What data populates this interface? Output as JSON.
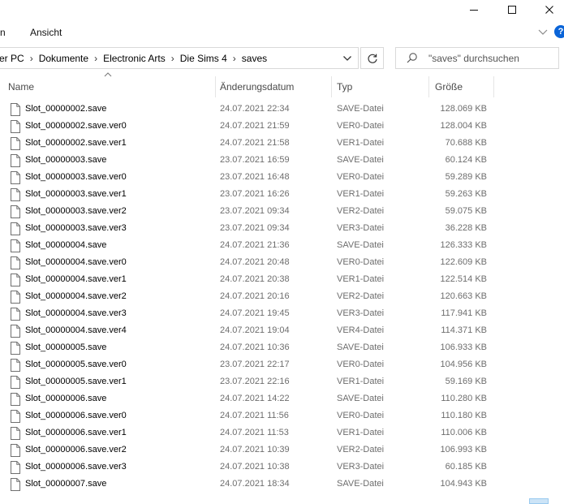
{
  "window": {
    "controls": [
      "minimize-icon",
      "maximize-icon",
      "close-icon"
    ]
  },
  "ribbon": {
    "tabs": [
      {
        "label": "n"
      },
      {
        "label": "Ansicht"
      }
    ],
    "help_label": "?"
  },
  "address": {
    "crumbs": [
      "er PC",
      "Dokumente",
      "Electronic Arts",
      "Die Sims 4",
      "saves"
    ],
    "separator": "›"
  },
  "search": {
    "placeholder": "\"saves\" durchsuchen"
  },
  "columns": {
    "name": "Name",
    "date": "Änderungsdatum",
    "type": "Typ",
    "size": "Größe"
  },
  "files": [
    {
      "name": "Slot_00000002.save",
      "date": "24.07.2021 22:34",
      "type": "SAVE-Datei",
      "size": "128.069 KB"
    },
    {
      "name": "Slot_00000002.save.ver0",
      "date": "24.07.2021 21:59",
      "type": "VER0-Datei",
      "size": "128.004 KB"
    },
    {
      "name": "Slot_00000002.save.ver1",
      "date": "24.07.2021 21:58",
      "type": "VER1-Datei",
      "size": "70.688 KB"
    },
    {
      "name": "Slot_00000003.save",
      "date": "23.07.2021 16:59",
      "type": "SAVE-Datei",
      "size": "60.124 KB"
    },
    {
      "name": "Slot_00000003.save.ver0",
      "date": "23.07.2021 16:48",
      "type": "VER0-Datei",
      "size": "59.289 KB"
    },
    {
      "name": "Slot_00000003.save.ver1",
      "date": "23.07.2021 16:26",
      "type": "VER1-Datei",
      "size": "59.263 KB"
    },
    {
      "name": "Slot_00000003.save.ver2",
      "date": "23.07.2021 09:34",
      "type": "VER2-Datei",
      "size": "59.075 KB"
    },
    {
      "name": "Slot_00000003.save.ver3",
      "date": "23.07.2021 09:34",
      "type": "VER3-Datei",
      "size": "36.228 KB"
    },
    {
      "name": "Slot_00000004.save",
      "date": "24.07.2021 21:36",
      "type": "SAVE-Datei",
      "size": "126.333 KB"
    },
    {
      "name": "Slot_00000004.save.ver0",
      "date": "24.07.2021 20:48",
      "type": "VER0-Datei",
      "size": "122.609 KB"
    },
    {
      "name": "Slot_00000004.save.ver1",
      "date": "24.07.2021 20:38",
      "type": "VER1-Datei",
      "size": "122.514 KB"
    },
    {
      "name": "Slot_00000004.save.ver2",
      "date": "24.07.2021 20:16",
      "type": "VER2-Datei",
      "size": "120.663 KB"
    },
    {
      "name": "Slot_00000004.save.ver3",
      "date": "24.07.2021 19:45",
      "type": "VER3-Datei",
      "size": "117.941 KB"
    },
    {
      "name": "Slot_00000004.save.ver4",
      "date": "24.07.2021 19:04",
      "type": "VER4-Datei",
      "size": "114.371 KB"
    },
    {
      "name": "Slot_00000005.save",
      "date": "24.07.2021 10:36",
      "type": "SAVE-Datei",
      "size": "106.933 KB"
    },
    {
      "name": "Slot_00000005.save.ver0",
      "date": "23.07.2021 22:17",
      "type": "VER0-Datei",
      "size": "104.956 KB"
    },
    {
      "name": "Slot_00000005.save.ver1",
      "date": "23.07.2021 22:16",
      "type": "VER1-Datei",
      "size": "59.169 KB"
    },
    {
      "name": "Slot_00000006.save",
      "date": "24.07.2021 14:22",
      "type": "SAVE-Datei",
      "size": "110.280 KB"
    },
    {
      "name": "Slot_00000006.save.ver0",
      "date": "24.07.2021 11:56",
      "type": "VER0-Datei",
      "size": "110.180 KB"
    },
    {
      "name": "Slot_00000006.save.ver1",
      "date": "24.07.2021 11:53",
      "type": "VER1-Datei",
      "size": "110.006 KB"
    },
    {
      "name": "Slot_00000006.save.ver2",
      "date": "24.07.2021 10:39",
      "type": "VER2-Datei",
      "size": "106.993 KB"
    },
    {
      "name": "Slot_00000006.save.ver3",
      "date": "24.07.2021 10:38",
      "type": "VER3-Datei",
      "size": "60.185 KB"
    },
    {
      "name": "Slot_00000007.save",
      "date": "24.07.2021 18:34",
      "type": "SAVE-Datei",
      "size": "104.943 KB"
    }
  ]
}
